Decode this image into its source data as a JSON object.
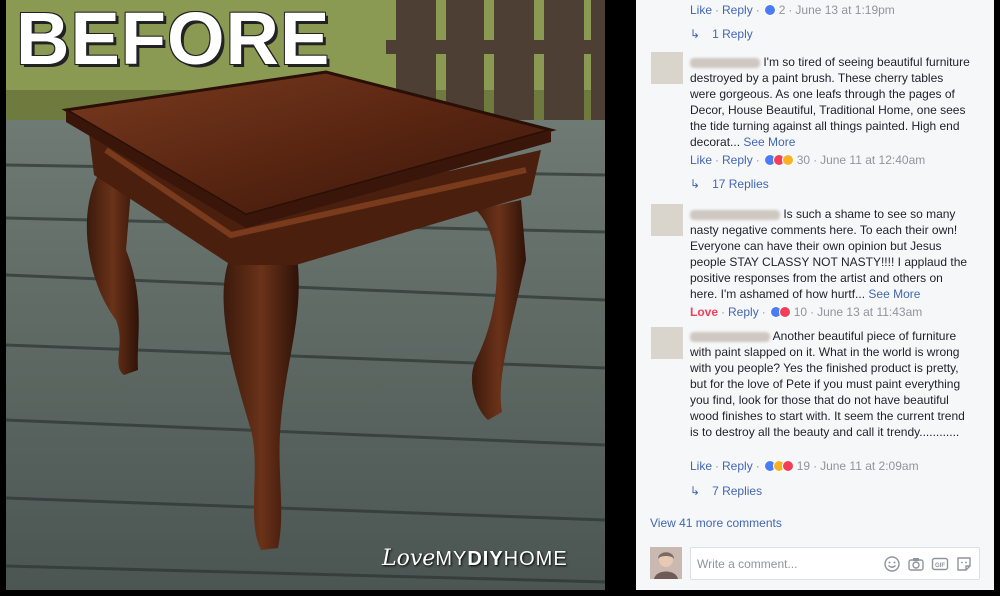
{
  "photo": {
    "title": "BEFORE",
    "watermark": {
      "love": "Love",
      "my": "MY",
      "diy": "DIY",
      "home": "HOME"
    }
  },
  "comments_panel": {
    "top_actions": {
      "like": "Like",
      "reply": "Reply",
      "count": "2",
      "time": "June 13 at 1:19pm"
    },
    "top_replies": "1 Reply",
    "comments": [
      {
        "text": "I'm so tired of seeing beautiful furniture destroyed by a paint brush. These cherry tables were gorgeous. As one leafs through the pages of Decor, House Beautiful, Traditional Home, one sees the tide turning against all things painted. High end decorat...",
        "see_more": "See More",
        "like": "Like",
        "reply": "Reply",
        "count": "30",
        "time": "June 11 at 12:40am",
        "replies": "17 Replies"
      },
      {
        "text": "Is such a shame to see so many nasty negative comments here. To each their own! Everyone can have their own opinion but Jesus people STAY CLASSY NOT NASTY!!!! I applaud the positive responses from the artist and others on here. I'm ashamed of how hurtf...",
        "see_more": "See More",
        "like": "Love",
        "reply": "Reply",
        "count": "10",
        "time": "June 13 at 11:43am"
      },
      {
        "text": "Another beautiful piece of furniture with paint slapped on it. What in the world is wrong with you people? Yes the finished product is pretty, but for the love of Pete if you must paint everything you find, look for those that do not have beautiful wood finishes to start with. It seem the current trend is to destroy all the beauty and call it trendy............",
        "like": "Like",
        "reply": "Reply",
        "count": "19",
        "time": "June 11 at 2:09am",
        "replies": "7 Replies"
      }
    ],
    "view_more": "View 41 more comments",
    "composer": {
      "placeholder": "Write a comment..."
    },
    "icons": [
      "emoji-icon",
      "camera-icon",
      "gif-icon",
      "sticker-icon"
    ]
  }
}
